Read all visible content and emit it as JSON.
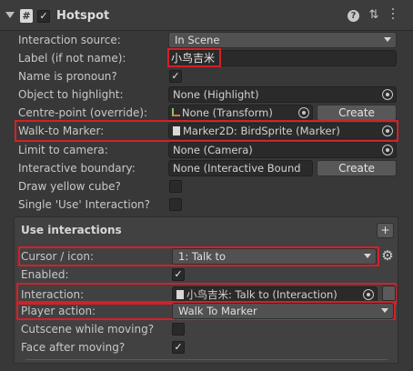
{
  "header": {
    "script_badge": "#",
    "title": "Hotspot",
    "icons": [
      "collapse-triangle-icon",
      "script-icon",
      "enabled-checkbox",
      "help-icon",
      "preset-icon",
      "kebab-menu-icon"
    ]
  },
  "fields": {
    "interaction_source": {
      "label": "Interaction source:",
      "value": "In Scene"
    },
    "label_if_not_name": {
      "label": "Label (if not name):",
      "value": "小鸟吉米"
    },
    "name_is_pronoun": {
      "label": "Name is pronoun?",
      "checked": true
    },
    "object_to_highlight": {
      "label": "Object to highlight:",
      "value": "None (Highlight)"
    },
    "centre_point": {
      "label": "Centre-point (override):",
      "value": "None (Transform)",
      "button": "Create"
    },
    "walk_to_marker": {
      "label": "Walk-to Marker:",
      "value": "Marker2D: BirdSprite (Marker)"
    },
    "limit_to_camera": {
      "label": "Limit to camera:",
      "value": "None (Camera)"
    },
    "interactive_boundary": {
      "label": "Interactive boundary:",
      "value": "None (Interactive Bound",
      "button": "Create"
    },
    "draw_yellow_cube": {
      "label": "Draw yellow cube?",
      "checked": false
    },
    "single_use_interaction": {
      "label": "Single 'Use' Interaction?",
      "checked": false
    }
  },
  "use_interactions": {
    "title": "Use interactions",
    "add_label": "+",
    "cursor_icon": {
      "label": "Cursor / icon:",
      "value": "1: Talk to"
    },
    "enabled": {
      "label": "Enabled:",
      "checked": true
    },
    "interaction": {
      "label": "Interaction:",
      "value": "小鸟吉米: Talk to (Interaction)"
    },
    "player_action": {
      "label": "Player action:",
      "value": "Walk To Marker"
    },
    "cutscene_while_moving": {
      "label": "Cutscene while moving?",
      "checked": false
    },
    "face_after_moving": {
      "label": "Face after moving?",
      "checked": true
    }
  },
  "colors": {
    "highlight": "#d42028",
    "background": "#383838",
    "panel": "#414141"
  }
}
